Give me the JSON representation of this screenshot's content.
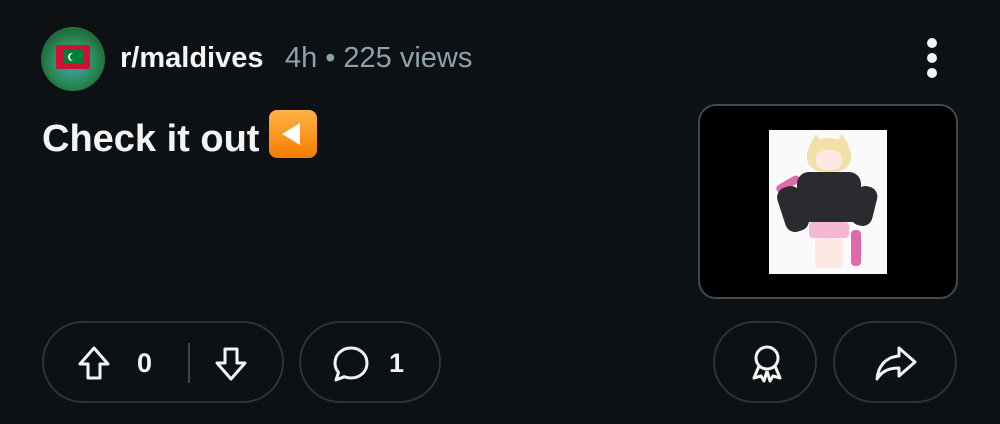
{
  "post": {
    "subreddit": "r/maldives",
    "age": "4h",
    "separator": "•",
    "views": "225 views",
    "title": "Check it out",
    "title_emoji": "reverse-button-emoji",
    "thumbnail": "anime-character-image"
  },
  "actions": {
    "vote_count": "0",
    "comment_count": "1"
  },
  "icons": {
    "more": "more-vertical-icon",
    "upvote": "arrow-up-icon",
    "downvote": "arrow-down-icon",
    "comment": "speech-bubble-icon",
    "award": "award-ribbon-icon",
    "share": "share-arrow-icon"
  },
  "colors": {
    "background": "#0e1113",
    "text": "#f2f4f5",
    "meta_text": "#8ba2ad",
    "pill_border": "#2c3438",
    "emoji_orange": "#f57c00"
  }
}
